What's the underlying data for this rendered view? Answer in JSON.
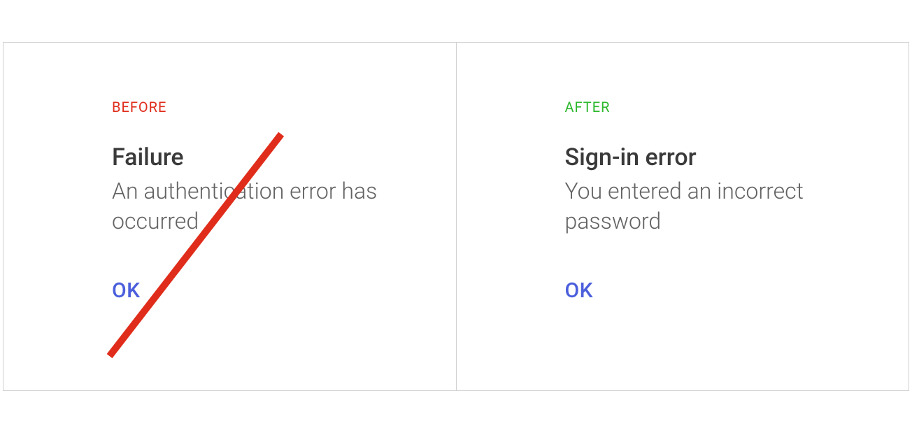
{
  "colors": {
    "before_tag": "#e02d1b",
    "after_tag": "#2db82d",
    "action": "#4b5fdc",
    "title": "#3a3a3a",
    "body": "#626262",
    "border": "#d0d0d0"
  },
  "panels": {
    "before": {
      "tag": "BEFORE",
      "title": "Failure",
      "body": "An authentication error has occurred",
      "action": "OK"
    },
    "after": {
      "tag": "AFTER",
      "title": "Sign-in error",
      "body": "You entered an incorrect password",
      "action": "OK"
    }
  }
}
